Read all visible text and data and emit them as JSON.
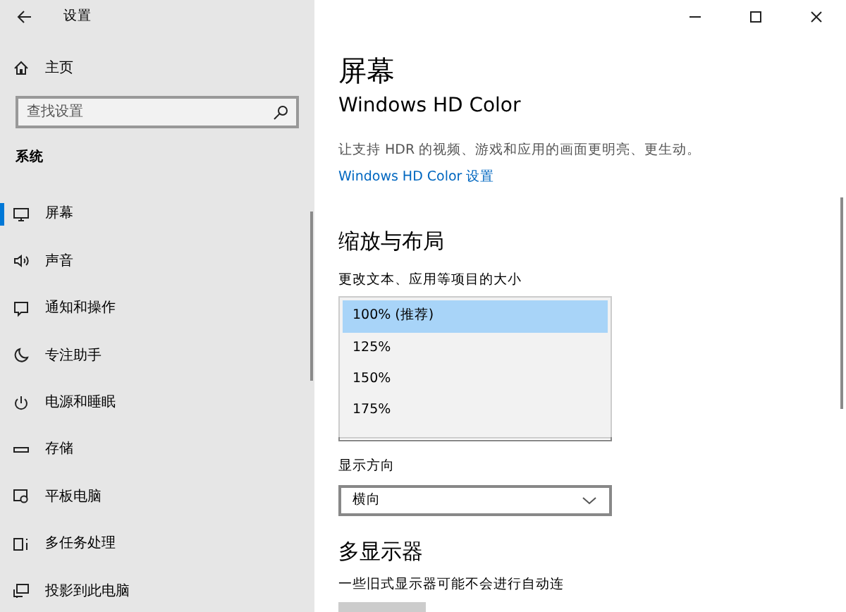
{
  "window": {
    "title": "设置"
  },
  "sidebar": {
    "home": "主页",
    "search": {
      "placeholder": "查找设置"
    },
    "section": "系统",
    "items": [
      {
        "label": "屏幕",
        "selected": true
      },
      {
        "label": "声音",
        "selected": false
      },
      {
        "label": "通知和操作",
        "selected": false
      },
      {
        "label": "专注助手",
        "selected": false
      },
      {
        "label": "电源和睡眠",
        "selected": false
      },
      {
        "label": "存储",
        "selected": false
      },
      {
        "label": "平板电脑",
        "selected": false
      },
      {
        "label": "多任务处理",
        "selected": false
      },
      {
        "label": "投影到此电脑",
        "selected": false
      }
    ]
  },
  "main": {
    "title": "屏幕",
    "hdr": {
      "heading": "Windows HD Color",
      "description": "让支持 HDR 的视频、游戏和应用的画面更明亮、更生动。",
      "link": "Windows HD Color 设置"
    },
    "scale": {
      "heading": "缩放与布局",
      "label": "更改文本、应用等项目的大小",
      "options": [
        {
          "label": "100% (推荐)",
          "selected": true
        },
        {
          "label": "125%",
          "selected": false
        },
        {
          "label": "150%",
          "selected": false
        },
        {
          "label": "175%",
          "selected": false
        }
      ]
    },
    "orientation": {
      "label": "显示方向",
      "value": "横向"
    },
    "multi": {
      "heading": "多显示器",
      "text": "一些旧式显示器可能不会进行自动连"
    }
  }
}
